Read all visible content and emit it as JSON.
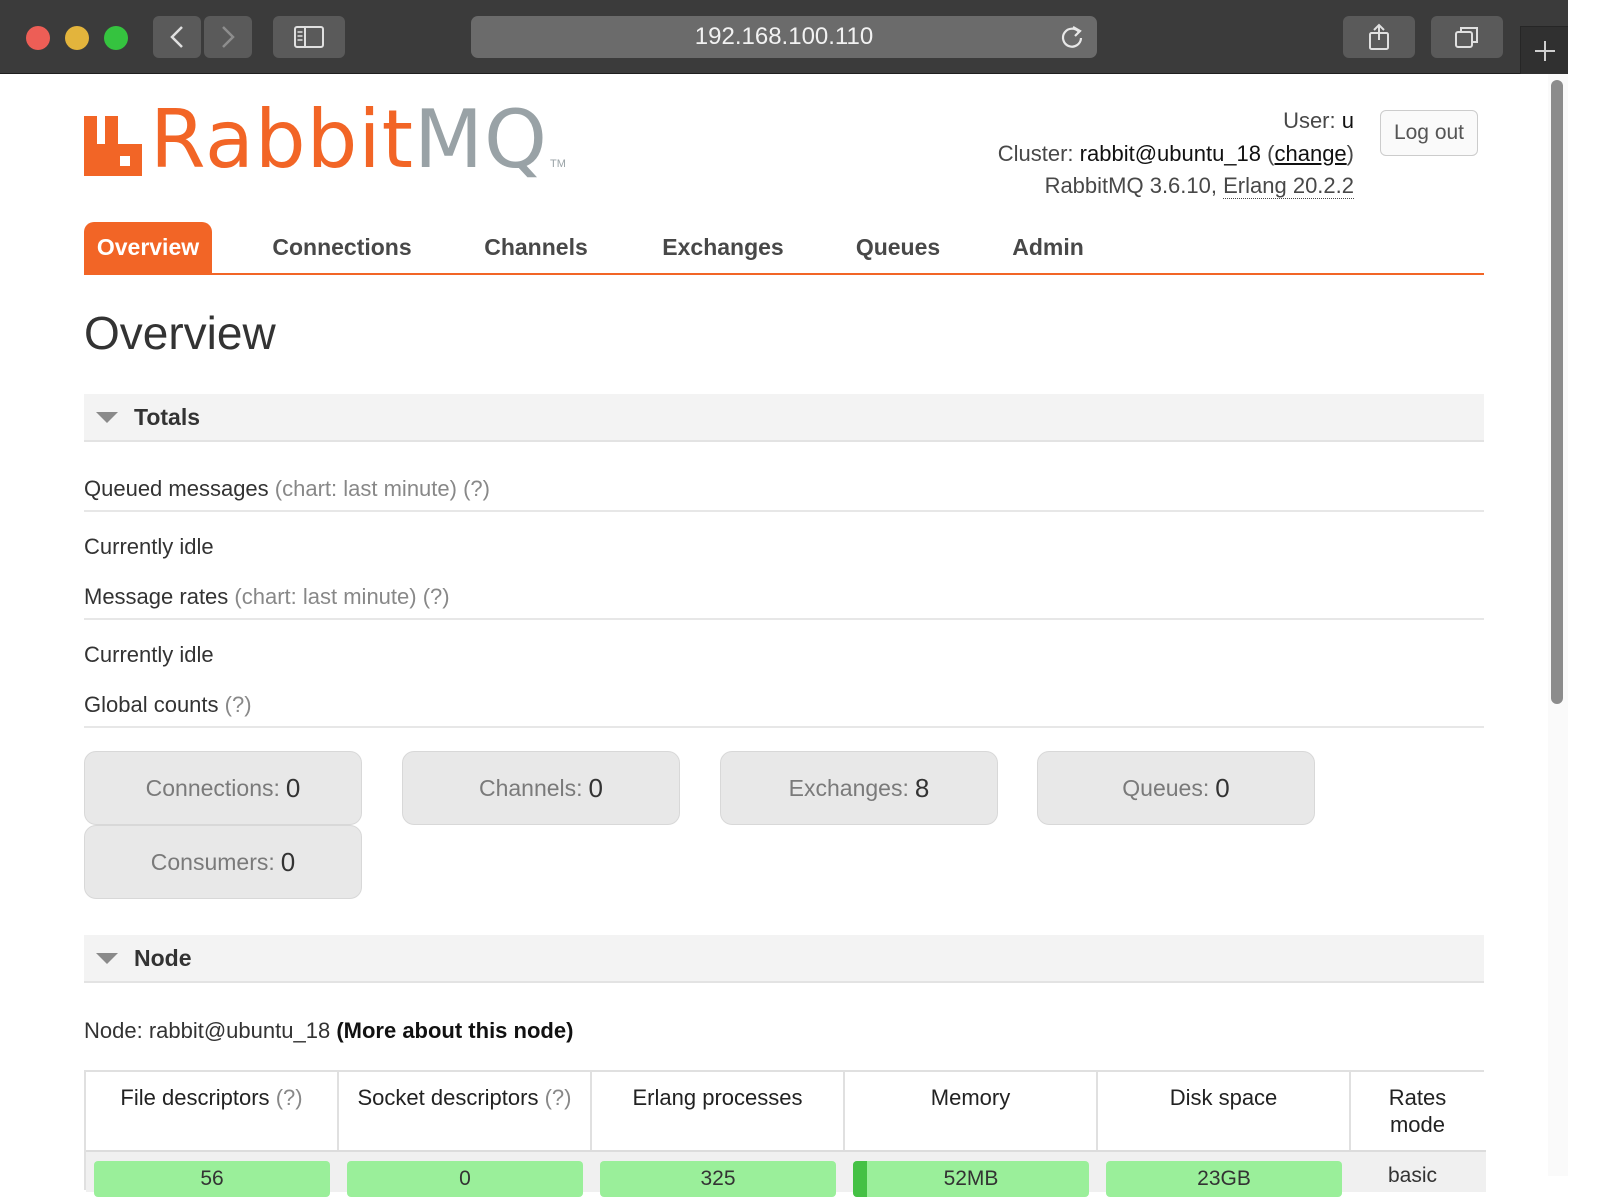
{
  "browser": {
    "url": "192.168.100.110"
  },
  "header": {
    "logo_text": "RabbitMQ",
    "logo_tm": "TM",
    "user_label": "User:",
    "user_value": "u",
    "cluster_label": "Cluster:",
    "cluster_value": "rabbit@ubuntu_18",
    "change_link": "change",
    "version_text": "RabbitMQ 3.6.10,",
    "erlang_text": "Erlang 20.2.2",
    "logout_label": "Log out"
  },
  "tabs": [
    {
      "label": "Overview",
      "active": true
    },
    {
      "label": "Connections",
      "active": false
    },
    {
      "label": "Channels",
      "active": false
    },
    {
      "label": "Exchanges",
      "active": false
    },
    {
      "label": "Queues",
      "active": false
    },
    {
      "label": "Admin",
      "active": false
    }
  ],
  "page_title": "Overview",
  "totals": {
    "heading": "Totals",
    "queued_label": "Queued messages",
    "queued_hint": "(chart: last minute) (?)",
    "queued_status": "Currently idle",
    "rates_label": "Message rates",
    "rates_hint": "(chart: last minute) (?)",
    "rates_status": "Currently idle",
    "global_label": "Global counts",
    "global_hint": "(?)",
    "counts": [
      {
        "label": "Connections:",
        "value": "0"
      },
      {
        "label": "Channels:",
        "value": "0"
      },
      {
        "label": "Exchanges:",
        "value": "8"
      },
      {
        "label": "Queues:",
        "value": "0"
      },
      {
        "label": "Consumers:",
        "value": "0"
      }
    ]
  },
  "node": {
    "heading": "Node",
    "node_label": "Node: rabbit@ubuntu_18",
    "more_link": "(More about this node)",
    "columns": [
      {
        "label": "File descriptors",
        "hint": "(?)"
      },
      {
        "label": "Socket descriptors",
        "hint": "(?)"
      },
      {
        "label": "Erlang processes",
        "hint": ""
      },
      {
        "label": "Memory",
        "hint": ""
      },
      {
        "label": "Disk space",
        "hint": ""
      },
      {
        "label": "Rates mode",
        "hint": ""
      }
    ],
    "values": [
      "56",
      "0",
      "325",
      "52MB",
      "23GB",
      "basic"
    ],
    "memory_fill_fraction": 0.06
  },
  "colors": {
    "accent": "#f26526",
    "bar_ok": "#9aef9a",
    "bar_fill": "#45c145"
  }
}
